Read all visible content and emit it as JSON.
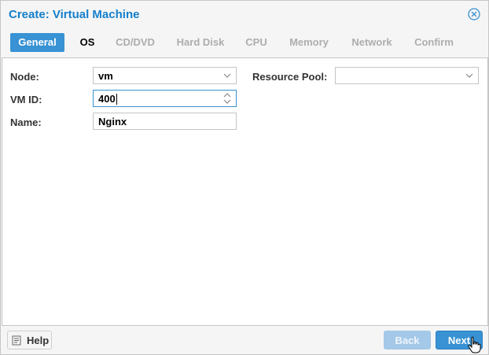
{
  "window": {
    "title": "Create: Virtual Machine"
  },
  "tabs": [
    {
      "label": "General",
      "state": "active"
    },
    {
      "label": "OS",
      "state": "enabled"
    },
    {
      "label": "CD/DVD",
      "state": "disabled"
    },
    {
      "label": "Hard Disk",
      "state": "disabled"
    },
    {
      "label": "CPU",
      "state": "disabled"
    },
    {
      "label": "Memory",
      "state": "disabled"
    },
    {
      "label": "Network",
      "state": "disabled"
    },
    {
      "label": "Confirm",
      "state": "disabled"
    }
  ],
  "form": {
    "node": {
      "label": "Node:",
      "value": "vm"
    },
    "vmid": {
      "label": "VM ID:",
      "value": "400"
    },
    "name": {
      "label": "Name:",
      "value": "Nginx"
    },
    "pool": {
      "label": "Resource Pool:",
      "value": ""
    }
  },
  "footer": {
    "help": "Help",
    "back": "Back",
    "next": "Next"
  },
  "colors": {
    "accent": "#3892d4",
    "title": "#157fcc",
    "disabled_button": "#a4c8e8"
  },
  "icons": [
    "close-icon",
    "help-icon",
    "chevron-down-icon",
    "spinner-icon",
    "hand-cursor-icon"
  ]
}
